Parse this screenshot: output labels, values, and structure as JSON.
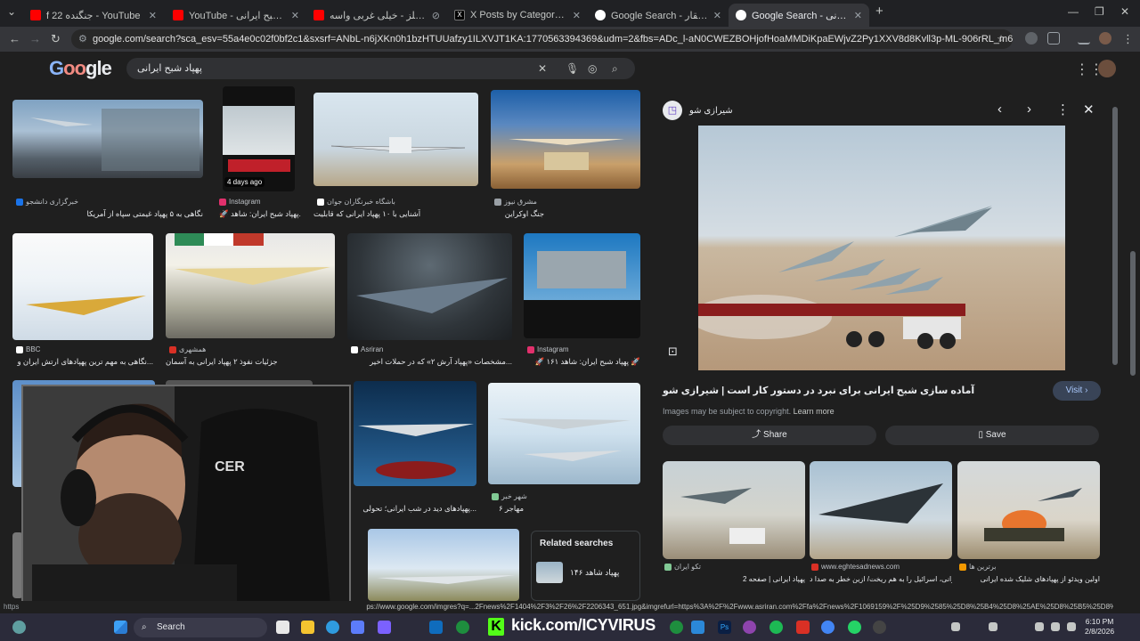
{
  "tabs": [
    {
      "title": "f 22 جنگنده - YouTube",
      "color": "#ff0000"
    },
    {
      "title": "YouTube - پهپاد شبح ایرانی",
      "color": "#ff0000"
    },
    {
      "title": "ایی لیتلز - خیلی غربی واسه",
      "color": "#ff0000"
    },
    {
      "title": "X Posts by Category | Iran Mon",
      "color": "#000000"
    },
    {
      "title": "Google Search - فایق ذوالفقار",
      "color": "#4285f4"
    },
    {
      "title": "Google Search - پهپاد شبح ایرانی",
      "color": "#4285f4"
    }
  ],
  "address": {
    "url": "google.com/search?sca_esv=55a4e0c02f0bf2c1&sxsrf=ANbL-n6jXKn0h1bzHTUUafzy1ILXVJT1KA:1770563394369&udm=2&fbs=ADc_l-aN0CWEZBOHjofHoaMMDiKpaEWjvZ2Py1XXV8d8Kvll3p-ML-906rRL_m6h4jR-tdAeyw6pOVABma0FfM0Nmt..."
  },
  "search": {
    "query": "پهپاد شبح ایرانی",
    "logo": "Google"
  },
  "grid": {
    "row1": [
      {
        "src": "خبرگزاری دانشجو",
        "cap": "نگاهی به ۵ پهپاد غیمتی سپاه از آمریکا"
      },
      {
        "src": "Instagram",
        "cap": "🚀 پهپاد شبح ایران: شاهد...",
        "badge": "4 days ago"
      },
      {
        "src": "باشگاه خبرنگاران جوان",
        "cap": "آشنایی با ۱۰ پهپاد ایرانی که قابلیت..."
      },
      {
        "src": "مشرق نیوز",
        "cap": "جنگ اوکراین"
      }
    ],
    "row2": [
      {
        "src": "BBC",
        "cap": "نگاهی به مهم ترین پهپادهای ارتش ایران و..."
      },
      {
        "src": "همشهری",
        "cap": "جزئیات نفوذ ۲ پهپاد ایرانی به آسمان..."
      },
      {
        "src": "Asriran",
        "cap": "مشخصات «پهپاد آرش ۲» که در حملات اخیر..."
      },
      {
        "src": "Instagram",
        "cap": "🚀 پهپاد شبح ایران: شاهد ۱۶۱ 🚀"
      }
    ],
    "row3": [
      {
        "src": "",
        "cap": "پهپادهای دید در شب ایرانی؛ تحولی..."
      },
      {
        "src": "شهر خبر",
        "cap": "مهاجر ۶"
      }
    ]
  },
  "related": {
    "heading": "Related searches",
    "item": "پهپاد شاهد ۱۴۶"
  },
  "panel": {
    "source": "شیرازی شو",
    "title": "آماده سازی شبح ایرانی برای نبرد در دستور کار است | شیرازی شو",
    "visit": "Visit",
    "copyright": "Images may be subject to copyright.",
    "learn_more": "Learn more",
    "share": "Share",
    "save": "Save",
    "related": [
      {
        "src": "تکو ایران",
        "cap": "پهپاد ایرانی | صفحه 2"
      },
      {
        "src": "www.eghtesadnews.com",
        "cap": "پهپاد ایرانی، اسرائیل را به هم ریخت/ ازین خطر به صدا د..."
      },
      {
        "src": "برترین ها",
        "cap": "اولین ویدئو از پهپادهای شلیک شده ایرانی"
      }
    ]
  },
  "status_url": "ps://www.google.com/imgres?q=...2Fnews%2F1404%2F3%2F26%2F2206343_651.jpg&imgrefurl=https%3A%2F%2Fwww.asriran.com%2Ffa%2Fnews%2F1069159%2F%25D9%2585%25D8%25B4%25D8%25AE%25D8%25B5%25D8%25A7%25D8%25AA-%25D9%2587%25D9%25BE%25D9%2587...",
  "taskbar": {
    "search": "Search",
    "kick": "kick.com/ICYVIRUS",
    "time": "6:10 PM",
    "date": "2/8/2026"
  }
}
